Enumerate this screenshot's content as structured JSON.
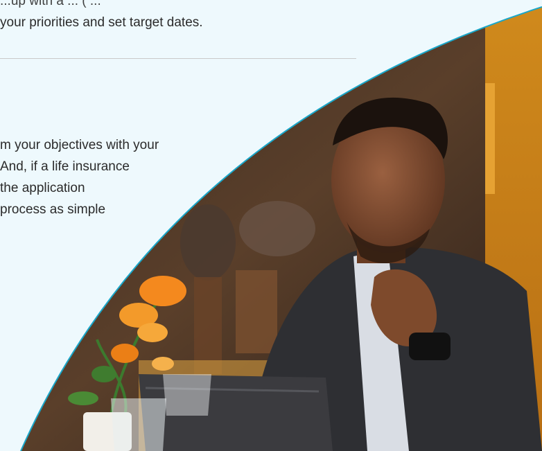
{
  "top_text": {
    "line_1": "...up with a ... ( ...",
    "line_2": "your priorities and set target dates."
  },
  "middle_text": {
    "lines": [
      "m your objectives with your",
      "And, if a life insurance",
      "the application",
      "process as simple"
    ]
  },
  "colors": {
    "background": "#eef9fd",
    "curve_accent": "#19a7c9",
    "text": "#2b2b2b"
  },
  "photo": {
    "subject": "man-in-cafe-with-laptop"
  }
}
